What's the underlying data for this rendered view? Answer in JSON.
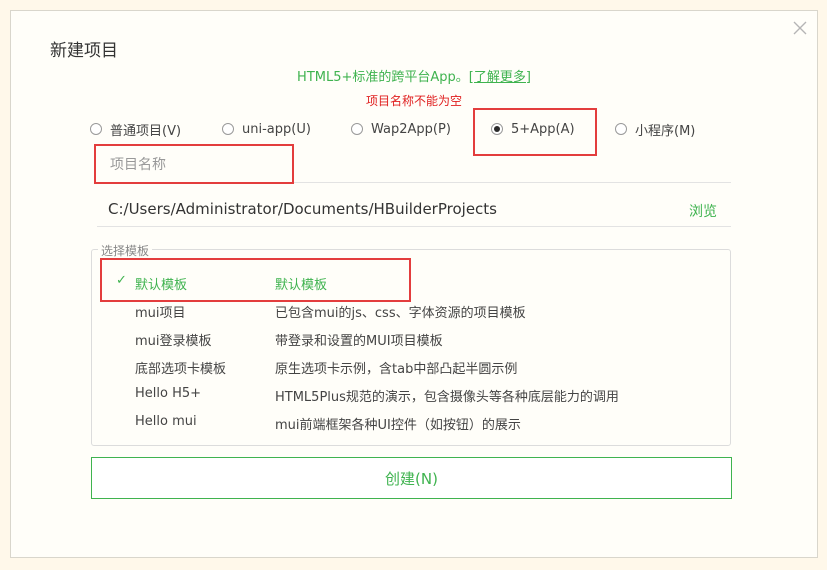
{
  "dialog": {
    "title": "新建项目",
    "subtitle": "HTML5+标准的跨平台App。",
    "learn_more": "[了解更多]",
    "error": "项目名称不能为空"
  },
  "project_types": [
    {
      "label": "普通项目(V)",
      "checked": false
    },
    {
      "label": "uni-app(U)",
      "checked": false
    },
    {
      "label": "Wap2App(P)",
      "checked": false
    },
    {
      "label": "5+App(A)",
      "checked": true
    },
    {
      "label": "小程序(M)",
      "checked": false
    }
  ],
  "name_field": {
    "placeholder": "项目名称",
    "value": ""
  },
  "path_field": {
    "value": "C:/Users/Administrator/Documents/HBuilderProjects",
    "browse_label": "浏览"
  },
  "templates": {
    "legend": "选择模板",
    "items": [
      {
        "name": "默认模板",
        "desc": "默认模板",
        "selected": true
      },
      {
        "name": "mui项目",
        "desc": "已包含mui的js、css、字体资源的项目模板",
        "selected": false
      },
      {
        "name": "mui登录模板",
        "desc": "带登录和设置的MUI项目模板",
        "selected": false
      },
      {
        "name": "底部选项卡模板",
        "desc": "原生选项卡示例，含tab中部凸起半圆示例",
        "selected": false
      },
      {
        "name": "Hello H5+",
        "desc": "HTML5Plus规范的演示，包含摄像头等各种底层能力的调用",
        "selected": false
      },
      {
        "name": "Hello mui",
        "desc": "mui前端框架各种UI控件（如按钮）的展示",
        "selected": false
      }
    ]
  },
  "create_button": "创建(N)",
  "colors": {
    "accent": "#3fb34f",
    "error": "#e02020",
    "highlight_box": "#e33d3d"
  }
}
